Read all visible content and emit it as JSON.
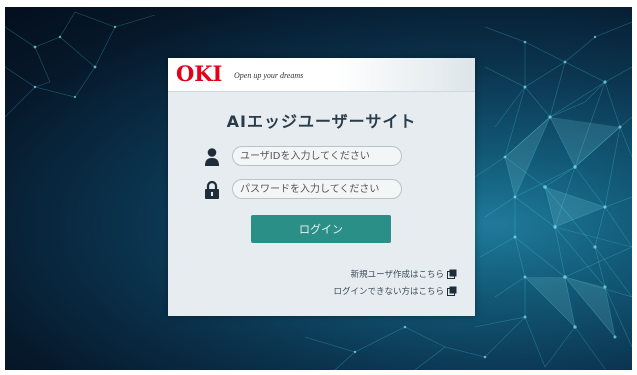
{
  "brand": {
    "logo": "OKI",
    "tagline": "Open up your dreams",
    "logo_color": "#e2001a"
  },
  "page": {
    "title": "AIエッジユーザーサイト"
  },
  "form": {
    "user_placeholder": "ユーザIDを入力してください",
    "password_placeholder": "パスワードを入力してください",
    "user_icon": "user-icon",
    "password_icon": "lock-icon",
    "login_label": "ログイン",
    "button_color": "#2a8f86"
  },
  "links": {
    "new_user": "新規ユーザ作成はこちら",
    "cannot_login": "ログインできない方はこちら",
    "link_icon": "new-window-icon"
  }
}
